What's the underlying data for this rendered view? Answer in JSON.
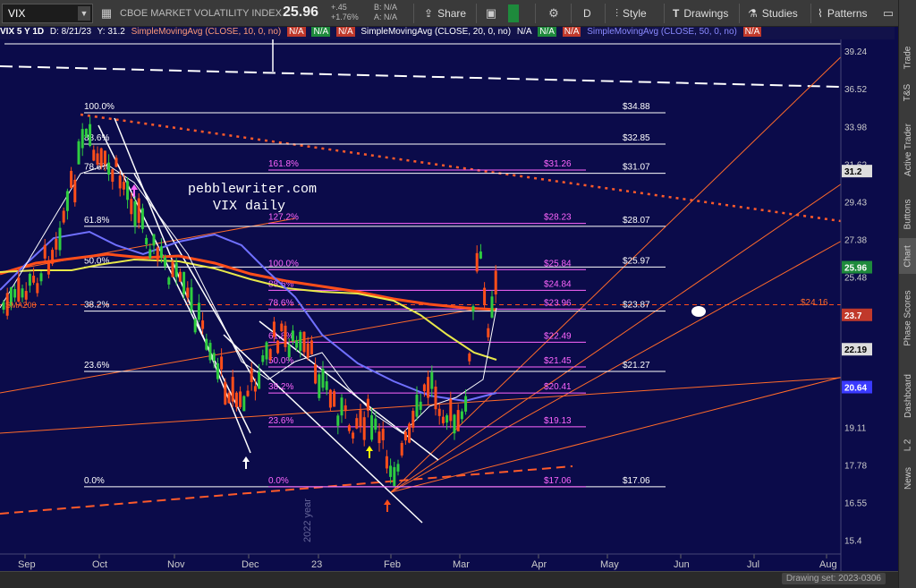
{
  "toolbar": {
    "symbol": "VIX",
    "symbol_name": "CBOE MARKET VOLATILITY INDEX",
    "last_price": "25.96",
    "change_abs": "+.45",
    "change_pct": "+1.76%",
    "bid": "B: N/A",
    "ask": "A: N/A",
    "share_label": "Share",
    "period_label": "D",
    "style_label": "Style",
    "drawings_label": "Drawings",
    "studies_label": "Studies",
    "patterns_label": "Patterns"
  },
  "study_line": {
    "symbol_info": "VIX 5 Y 1D",
    "date_info": "D: 8/21/23",
    "y_info": "Y: 31.2",
    "sma10": "SimpleMovingAvg (CLOSE, 10, 0, no)",
    "sma20": "SimpleMovingAvg (CLOSE, 20, 0, no)",
    "sma50": "SimpleMovingAvg (CLOSE, 50, 0, no)",
    "na": "N/A"
  },
  "sidebar_tabs": [
    "Trade",
    "T&S",
    "Active Trader",
    "Buttons",
    "Chart",
    "Phase Scores",
    "Dashboard",
    "L 2",
    "News"
  ],
  "colors": {
    "background": "#0b0b4a",
    "up_candle": "#2ecc40",
    "down_candle": "#ff4e1a",
    "fib_white": "#ffffff",
    "fib_magenta": "#ff66ff",
    "sma10": "#ffffff",
    "sma20": "#e8e84a",
    "sma50": "#7070ff",
    "sma200": "#ff4e1a",
    "trend_orange": "#ff6a2a"
  },
  "watermark": {
    "line1": "pebblewriter.com",
    "line2": "VIX daily",
    "year_label": "2022 year",
    "sma200_label": "SMA200"
  },
  "fib_levels_white": [
    {
      "pct": "100.0%",
      "price": "$34.88"
    },
    {
      "pct": "88.6%",
      "price": "$32.85"
    },
    {
      "pct": "78.6%",
      "price": "$31.07"
    },
    {
      "pct": "61.8%",
      "price": "$28.07"
    },
    {
      "pct": "50.0%",
      "price": "$25.97"
    },
    {
      "pct": "38.2%",
      "price": "$23.87"
    },
    {
      "pct": "23.6%",
      "price": "$21.27"
    },
    {
      "pct": "0.0%",
      "price": "$17.06"
    }
  ],
  "fib_levels_magenta": [
    {
      "pct": "161.8%",
      "price": "$31.26"
    },
    {
      "pct": "127.2%",
      "price": "$28.23"
    },
    {
      "pct": "100.0%",
      "price": "$25.84"
    },
    {
      "pct": "88.6%",
      "price": "$24.84"
    },
    {
      "pct": "78.6%",
      "price": "$23.96"
    },
    {
      "pct": "61.8%",
      "price": "$22.49"
    },
    {
      "pct": "50.0%",
      "price": "$21.45"
    },
    {
      "pct": "38.2%",
      "price": "$20.41"
    },
    {
      "pct": "23.6%",
      "price": "$19.13"
    },
    {
      "pct": "0.0%",
      "price": "$17.06"
    }
  ],
  "extra_label": "$24.16",
  "y_axis_ticks": [
    "39.24",
    "36.52",
    "33.98",
    "31.62",
    "29.43",
    "27.38",
    "25.48",
    "23.7",
    "22.19",
    "20.64",
    "19.11",
    "17.78",
    "16.55",
    "15.4"
  ],
  "price_tags": [
    {
      "value": "31.2",
      "bg": "#dddddd",
      "fg": "#000000"
    },
    {
      "value": "25.96",
      "bg": "#1e8a3c",
      "fg": "#ffffff"
    },
    {
      "value": "23.7",
      "bg": "#c0392b",
      "fg": "#ffffff"
    },
    {
      "value": "22.19",
      "bg": "#dddddd",
      "fg": "#000000"
    },
    {
      "value": "20.64",
      "bg": "#3a3aff",
      "fg": "#ffffff"
    }
  ],
  "x_axis_labels": [
    "Sep",
    "Oct",
    "Nov",
    "Dec",
    "23",
    "Feb",
    "Mar",
    "Apr",
    "May",
    "Jun",
    "Jul",
    "Aug"
  ],
  "drawing_set": "Drawing set: 2023-0306"
}
